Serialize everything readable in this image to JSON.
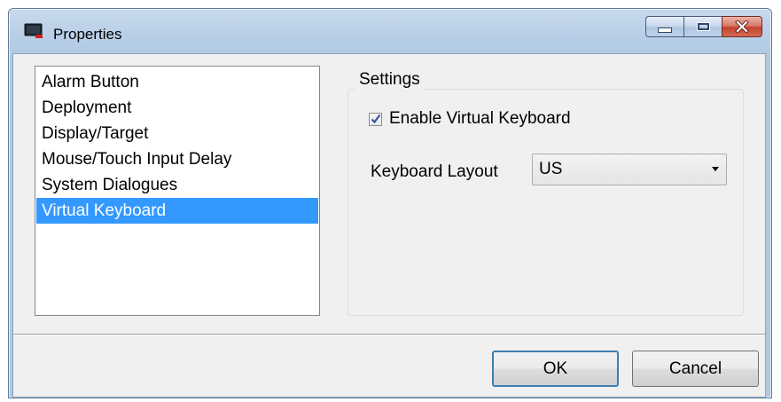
{
  "window": {
    "title": "Properties"
  },
  "sidebar": {
    "items": [
      {
        "label": "Alarm Button"
      },
      {
        "label": "Deployment"
      },
      {
        "label": "Display/Target"
      },
      {
        "label": "Mouse/Touch Input Delay"
      },
      {
        "label": "System Dialogues"
      },
      {
        "label": "Virtual Keyboard",
        "selected": true
      }
    ]
  },
  "settings": {
    "group_label": "Settings",
    "enable_vk_label": "Enable Virtual Keyboard",
    "enable_vk_checked": true,
    "layout_label": "Keyboard Layout",
    "layout_value": "US"
  },
  "footer": {
    "ok_label": "OK",
    "cancel_label": "Cancel"
  },
  "colors": {
    "selection": "#3399ff",
    "close_button": "#c4452f",
    "titlebar": "#b9cfe7"
  },
  "icons": [
    "app-monitor-icon",
    "minimize-icon",
    "maximize-icon",
    "close-icon",
    "checkmark-icon",
    "dropdown-arrow-icon"
  ]
}
